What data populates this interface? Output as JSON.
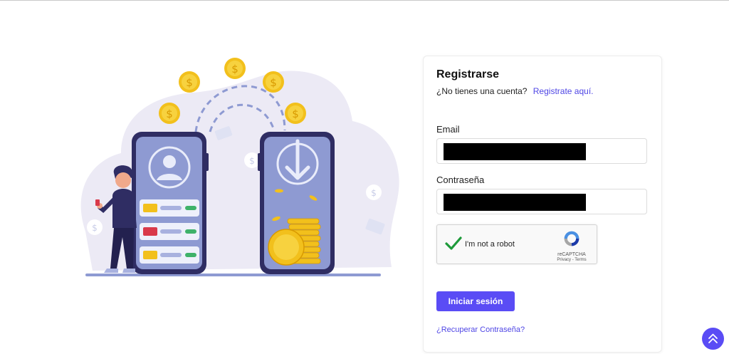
{
  "login": {
    "title": "Registrarse",
    "no_account_text": "¿No tienes una cuenta?",
    "register_link": "Registrate aquí.",
    "email_label": "Email",
    "password_label": "Contraseña",
    "submit_label": "Iniciar sesión",
    "forgot_link": "¿Recuperar Contraseña?"
  },
  "recaptcha": {
    "label": "I'm not a robot",
    "brand": "reCAPTCHA",
    "terms": "Privacy - Terms"
  },
  "colors": {
    "accent": "#5a4cf5",
    "phone": "#8e9ad2",
    "phone_frame": "#2f2d63",
    "coin": "#f2c01c",
    "blob": "#eceaf5"
  },
  "icons": [
    "arrow-up-double-icon",
    "checkmark-icon",
    "recaptcha-logo-icon"
  ]
}
